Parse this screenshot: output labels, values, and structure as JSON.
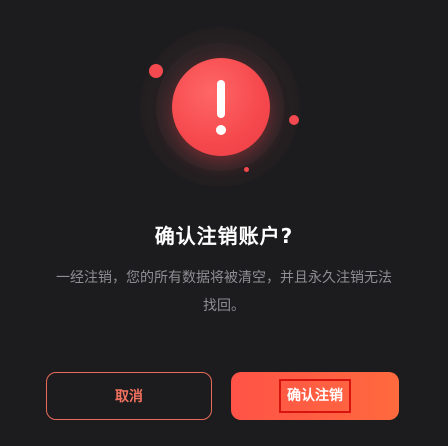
{
  "dialog": {
    "title": "确认注销账户?",
    "message": "一经注销，您的所有数据将被清空，并且永久注销无法找回。",
    "icon": "exclamation-icon",
    "colors": {
      "accent": "#f5484d",
      "background": "#1c1c1e",
      "cancel_text": "#f2705f",
      "confirm_gradient_start": "#ff5347",
      "confirm_gradient_end": "#ff6a3e"
    },
    "cancel_label": "取消",
    "confirm_label": "确认注销"
  }
}
